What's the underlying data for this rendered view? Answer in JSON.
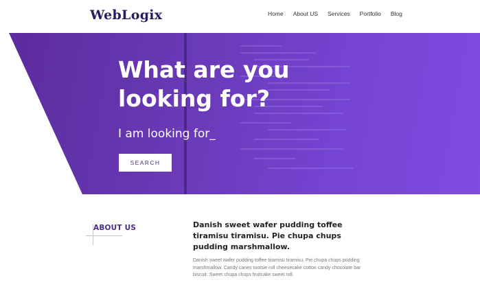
{
  "header": {
    "logo": "WebLogix",
    "nav": [
      "Home",
      "About US",
      "Services",
      "Portfolio",
      "Blog"
    ]
  },
  "hero": {
    "title_line1": "What are you",
    "title_line2": "looking for?",
    "subtitle": "I am looking for_",
    "search_button": "SEARCH"
  },
  "about": {
    "label": "ABOUT US",
    "heading": "Danish sweet wafer pudding toffee tiramisu tiramisu. Pie chupa chups pudding marshmallow.",
    "body": "Danish sweet wafer pudding toffee tiramisu tiramisu. Pie chupa chups pudding marshmallow. Candy canes tootsie roll cheesecake cotton candy chocolate bar biscuit. Sweet chupa chups fruitcake sweet roll."
  },
  "colors": {
    "brand": "#2a1a5e",
    "hero_start": "#5b2b9c",
    "hero_end": "#7c4de0",
    "accent": "#4a2a8a"
  }
}
